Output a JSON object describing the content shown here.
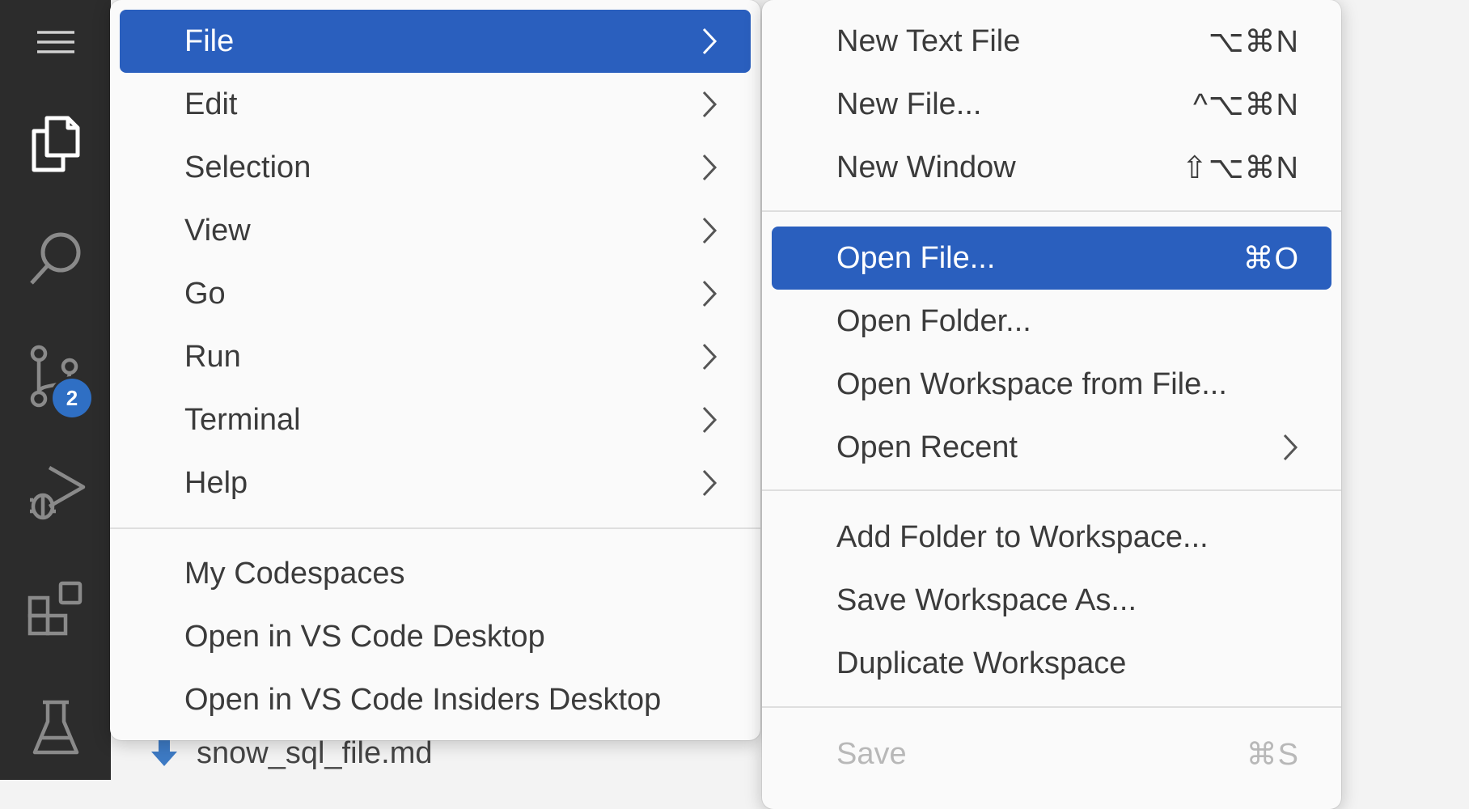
{
  "activity_bar": {
    "icons": [
      "menu-icon",
      "files-icon",
      "search-icon",
      "source-control-icon",
      "run-debug-icon",
      "extensions-icon",
      "flask-icon"
    ],
    "source_control_badge": "2"
  },
  "explorer": {
    "file_name": "snow_sql_file.md",
    "file_icon": "download-arrow-icon"
  },
  "main_menu": {
    "items": [
      {
        "label": "File"
      },
      {
        "label": "Edit"
      },
      {
        "label": "Selection"
      },
      {
        "label": "View"
      },
      {
        "label": "Go"
      },
      {
        "label": "Run"
      },
      {
        "label": "Terminal"
      },
      {
        "label": "Help"
      }
    ],
    "extra_items": [
      {
        "label": "My Codespaces"
      },
      {
        "label": "Open in VS Code Desktop"
      },
      {
        "label": "Open in VS Code Insiders Desktop"
      }
    ]
  },
  "file_submenu": {
    "items": [
      {
        "label": "New Text File",
        "shortcut": "⌥⌘N"
      },
      {
        "label": "New File...",
        "shortcut": "^⌥⌘N"
      },
      {
        "label": "New Window",
        "shortcut": "⇧⌥⌘N"
      },
      {
        "label": "Open File...",
        "shortcut": "⌘O"
      },
      {
        "label": "Open Folder...",
        "shortcut": ""
      },
      {
        "label": "Open Workspace from File...",
        "shortcut": ""
      },
      {
        "label": "Open Recent",
        "shortcut": ""
      },
      {
        "label": "Add Folder to Workspace...",
        "shortcut": ""
      },
      {
        "label": "Save Workspace As...",
        "shortcut": ""
      },
      {
        "label": "Duplicate Workspace",
        "shortcut": ""
      },
      {
        "label": "Save",
        "shortcut": "⌘S"
      }
    ]
  },
  "colors": {
    "highlight": "#2a5fbe",
    "activity_bar": "#2c2c2c",
    "badge": "#2f6fc4"
  }
}
